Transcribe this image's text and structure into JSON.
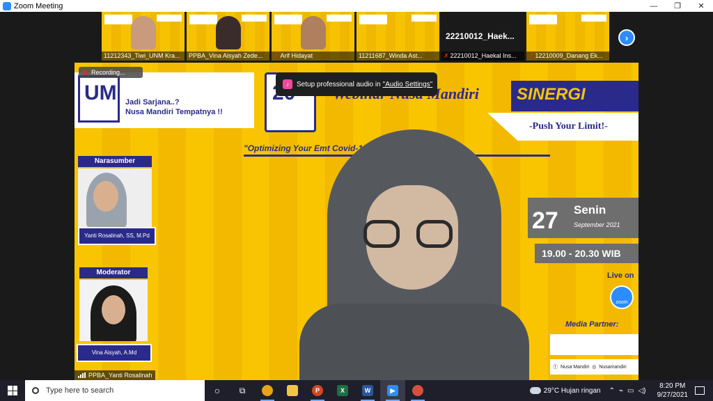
{
  "window": {
    "title": "Zoom Meeting",
    "controls": [
      "—",
      "❐",
      "✕"
    ]
  },
  "participants": [
    {
      "name": "11212343_Tiwi_UNM Kra...",
      "muted": false,
      "type": "video"
    },
    {
      "name": "PPBA_Vina Aisyah Zede...",
      "muted": false,
      "type": "video"
    },
    {
      "name": "Arif Hidayat",
      "muted": true,
      "type": "video"
    },
    {
      "name": "11211687_Winda Ast...",
      "muted": false,
      "type": "video"
    },
    {
      "name": "22210012_Haekal Ins...",
      "muted": true,
      "type": "name-only",
      "display": "22210012_Haek..."
    },
    {
      "name": "12210009_Danang Ek...",
      "muted": true,
      "type": "video"
    }
  ],
  "next_page_icon": "chevron-right-icon",
  "recording": {
    "label": "Recording..."
  },
  "audio_tip": {
    "text": "Setup professional audio in",
    "link": "\"Audio Settings\""
  },
  "slide": {
    "tagline_1": "Jadi Sarjana..?",
    "tagline_2": "Nusa Mandiri Tempatnya !!",
    "university_mark": "UM",
    "anniversary": "20",
    "webinar_title": "Webinar Nusa Mandiri",
    "brand": "SINERGI",
    "slogan": "-Push Your Limit!-",
    "theme": "\"Optimizing Your Emt Covid-19 Outbreak\"",
    "narasumber_label": "Narasumber",
    "narasumber_name": "Yanti Rosalinah, SS, M.Pd",
    "moderator_label": "Moderator",
    "moderator_name": "Vina Aisyah, A.Md",
    "day": "27",
    "weekday": "Senin",
    "month": "September 2021",
    "time": "19.00 - 20.30 WIB",
    "live_on": "Live on",
    "zoom_text": "zoom",
    "media_partners": "Media Partner:",
    "social": [
      "Nusa Mandiri",
      "Nusamandiri"
    ]
  },
  "active_speaker": "PPBA_Yanti Rosalinah",
  "taskbar": {
    "search_placeholder": "Type here to search",
    "apps": [
      {
        "name": "cortana-icon",
        "color": "#ffffff",
        "glyph": "○"
      },
      {
        "name": "task-view-icon",
        "color": "#ffffff",
        "glyph": "⧉"
      },
      {
        "name": "chrome-icon",
        "color": "#e8a317",
        "glyph": "●"
      },
      {
        "name": "file-explorer-icon",
        "color": "#f4c542",
        "glyph": "▬"
      },
      {
        "name": "powerpoint-icon",
        "color": "#d24726",
        "glyph": "P"
      },
      {
        "name": "excel-icon",
        "color": "#1d6f42",
        "glyph": "X"
      },
      {
        "name": "word-icon",
        "color": "#2b579a",
        "glyph": "W"
      },
      {
        "name": "zoom-icon",
        "color": "#2d8cff",
        "glyph": "▶"
      },
      {
        "name": "chrome-profile-icon",
        "color": "#d94f3d",
        "glyph": "●"
      }
    ],
    "weather": "29°C  Hujan ringan",
    "time": "8:20 PM",
    "date": "9/27/2021"
  }
}
